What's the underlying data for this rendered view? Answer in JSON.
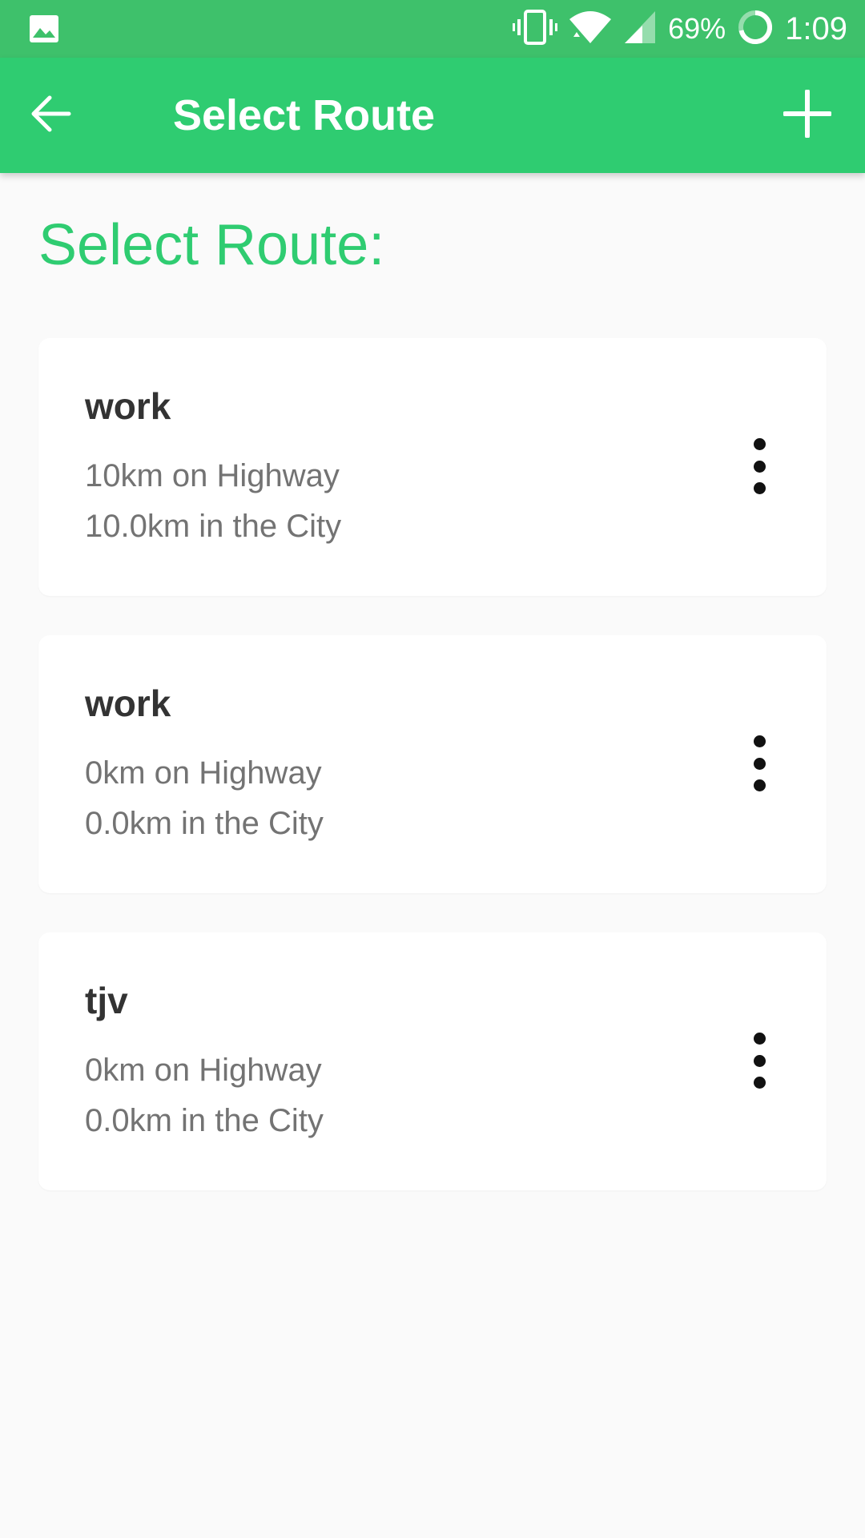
{
  "status_bar": {
    "battery": "69%",
    "time": "1:09",
    "icons": [
      "image-icon",
      "vibrate-icon",
      "wifi-icon",
      "signal-icon",
      "battery-ring-icon"
    ]
  },
  "app_bar": {
    "title": "Select Route",
    "back_icon": "arrow-back-icon",
    "add_icon": "plus-icon",
    "color": "#2fcc71"
  },
  "page": {
    "heading": "Select Route:"
  },
  "routes": [
    {
      "name": "work",
      "highway": "10km on Highway",
      "city": "10.0km in the City"
    },
    {
      "name": "work",
      "highway": "0km on Highway",
      "city": "0.0km in the City"
    },
    {
      "name": "tjv",
      "highway": "0km on Highway",
      "city": "0.0km in the City"
    }
  ],
  "colors": {
    "accent": "#2fcc71",
    "status_bar": "#3ec16b",
    "background": "#fafafa",
    "card": "#ffffff"
  }
}
